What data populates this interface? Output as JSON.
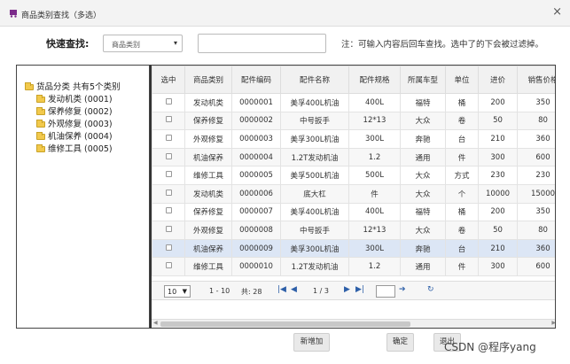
{
  "dialog": {
    "title": "商品类别查找（多选）",
    "close": "×"
  },
  "search": {
    "label": "快速查找:",
    "select_value": "商品类别",
    "input_value": "",
    "hint": "注：可输入内容后回车查找。选中了的下会被过滤掉。"
  },
  "tree": {
    "root": "货品分类  共有5个类别",
    "nodes": [
      "发动机类 (0001)",
      "保养修复 (0002)",
      "外观修复 (0003)",
      "机油保养 (0004)",
      "维修工具 (0005)"
    ]
  },
  "grid": {
    "columns": [
      "选中",
      "商品类别",
      "配件编码",
      "配件名称",
      "配件规格",
      "所属车型",
      "单位",
      "进价",
      "销售价格"
    ],
    "rows": [
      [
        "",
        "发动机类",
        "0000001",
        "美孚400L机油",
        "400L",
        "福特",
        "桶",
        "200",
        "350"
      ],
      [
        "",
        "保养修复",
        "0000002",
        "中号扳手",
        "12*13",
        "大众",
        "卷",
        "50",
        "80"
      ],
      [
        "",
        "外观修复",
        "0000003",
        "美孚300L机油",
        "300L",
        "奔驰",
        "台",
        "210",
        "360"
      ],
      [
        "",
        "机油保养",
        "0000004",
        "1.2T发动机油",
        "1.2",
        "通用",
        "件",
        "300",
        "600"
      ],
      [
        "",
        "维修工具",
        "0000005",
        "美孚500L机油",
        "500L",
        "大众",
        "方式",
        "230",
        "230"
      ],
      [
        "",
        "发动机类",
        "0000006",
        "底大杠",
        "件",
        "大众",
        "个",
        "10000",
        "15000"
      ],
      [
        "",
        "保养修复",
        "0000007",
        "美孚400L机油",
        "400L",
        "福特",
        "桶",
        "200",
        "350"
      ],
      [
        "",
        "外观修复",
        "0000008",
        "中号扳手",
        "12*13",
        "大众",
        "卷",
        "50",
        "80"
      ],
      [
        "",
        "机油保养",
        "0000009",
        "美孚300L机油",
        "300L",
        "奔驰",
        "台",
        "210",
        "360"
      ],
      [
        "",
        "维修工具",
        "0000010",
        "1.2T发动机油",
        "1.2",
        "通用",
        "件",
        "300",
        "600"
      ]
    ],
    "selected_row": 8
  },
  "pager": {
    "page_size": "10",
    "range": "1 - 10",
    "total": "共: 28",
    "page": "1 / 3",
    "first": "|◀",
    "prev": "◀",
    "next": "▶",
    "last": "▶|",
    "go": "➔",
    "refresh": "↻"
  },
  "buttons": {
    "add": "新增加",
    "ok": "确定",
    "back": "退出"
  },
  "watermark": "CSDN @程序yang",
  "colors": {
    "selected_row": "#dce6f5",
    "folder": "#f2c94c",
    "pager_icon": "#2d5fa8"
  }
}
